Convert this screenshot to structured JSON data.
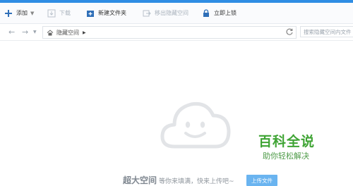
{
  "toolbar": {
    "add": {
      "label": "添加",
      "icon": "plus-icon"
    },
    "download": {
      "label": "下载",
      "icon": "download-icon"
    },
    "new_folder": {
      "label": "新建文件夹",
      "icon": "new-folder-icon"
    },
    "move_out": {
      "label": "移出隐藏空间",
      "icon": "move-out-icon"
    },
    "lock": {
      "label": "立即上锁",
      "icon": "lock-icon"
    }
  },
  "addressbar": {
    "path": "隐藏空间",
    "search_placeholder": "搜索隐藏空间内文件"
  },
  "empty_state": {
    "title": "超大空间",
    "subtitle": "等你来填满，快来上传吧~",
    "upload_button": "上传文件"
  },
  "watermark": {
    "main": "百科全说",
    "sub": "助你轻松解决"
  },
  "colors": {
    "accent": "#2f8de4",
    "upload_button": "#6ab4f0",
    "watermark": "#3fa434"
  }
}
